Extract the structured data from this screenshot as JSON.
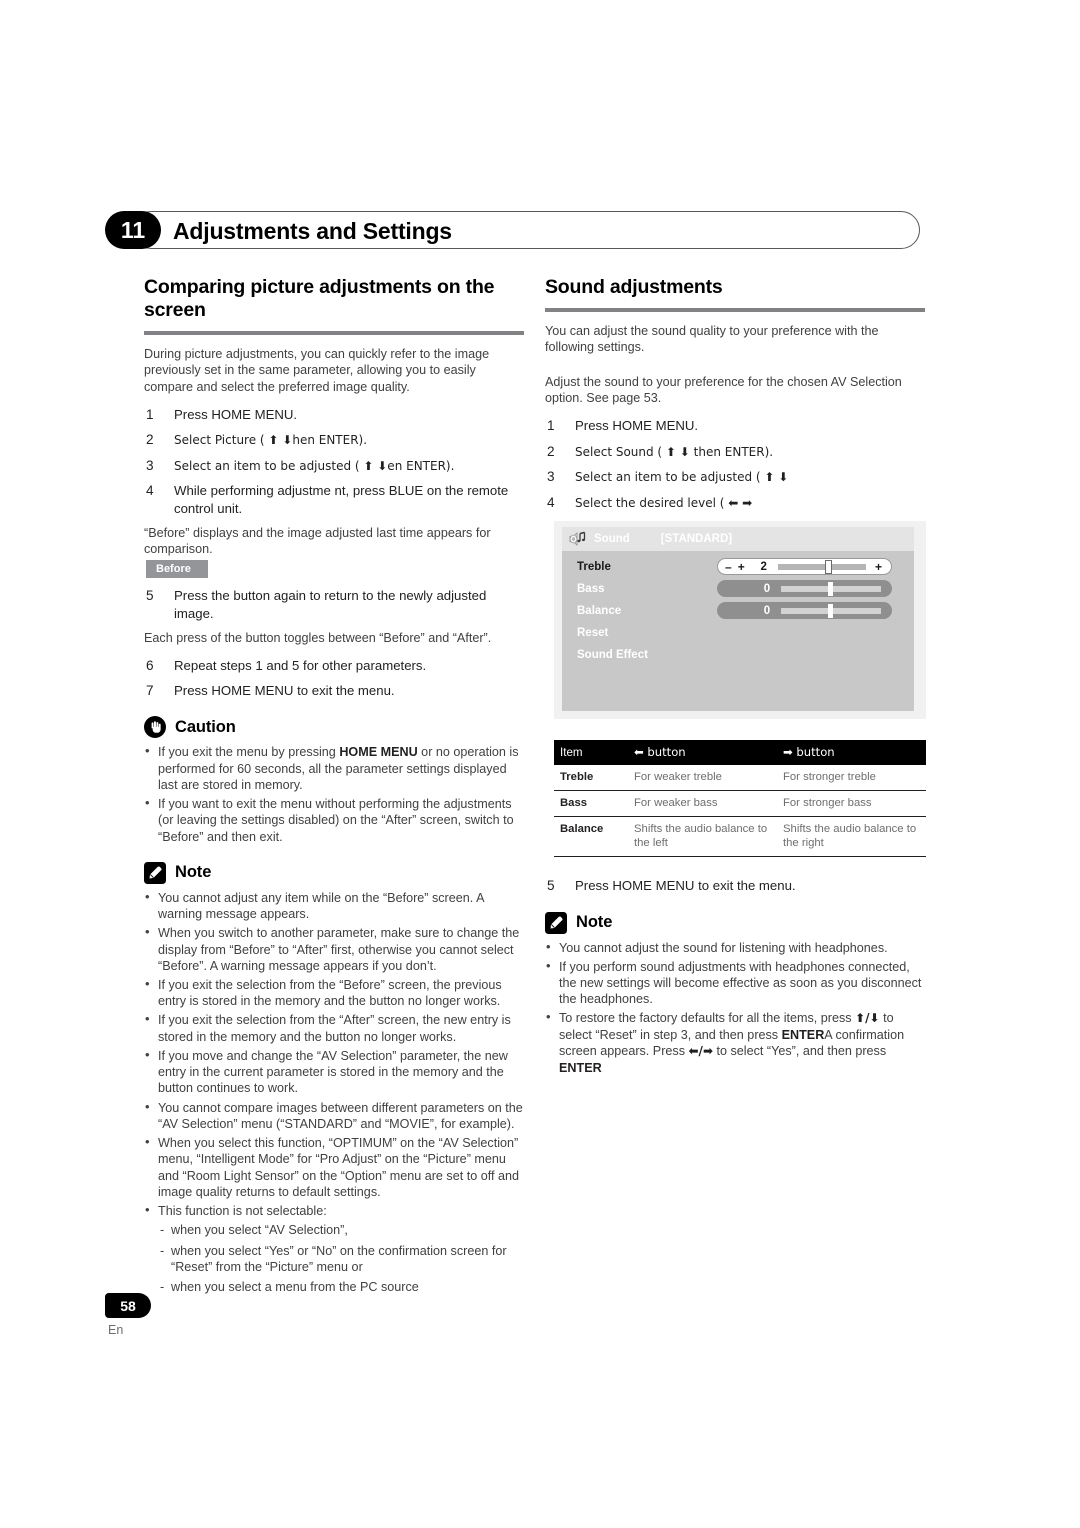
{
  "chapter": {
    "number": "11",
    "title": "Adjustments and Settings"
  },
  "left_column": {
    "heading": "Comparing picture adjustments on the screen",
    "intro": "During picture adjustments, you can quickly refer to the image previously set in the same parameter, allowing you to easily compare and select the preferred image quality.",
    "steps": [
      {
        "num": "1",
        "text": "Press HOME MENU."
      },
      {
        "num": "2",
        "text": "Select  Picture  (  ⬆ ⬇hen ENTER)."
      },
      {
        "num": "3",
        "text": "Select an item to be adjusted (   ⬆ ⬇en ENTER)."
      },
      {
        "num": "4",
        "text": "While performing adjustme    nt, press BLUE on the remote control unit."
      }
    ],
    "after_step4": "“Before” displays and the image adjusted last time appears for comparison.",
    "before_badge": "Before",
    "steps2": [
      {
        "num": "5",
        "text": "Press the button again to return to the newly adjusted image."
      }
    ],
    "after_step5": "Each press of the button toggles between “Before” and “After”.",
    "steps3": [
      {
        "num": "6",
        "text": "Repeat steps 1 and 5 for other parameters."
      },
      {
        "num": "7",
        "text": "Press HOME MENU to exit the menu."
      }
    ],
    "caution": {
      "title": "Caution",
      "icon": "hand-stop-icon",
      "bullets": [
        "If you exit the menu by pressing HOME MENU or no operation is performed for 60 seconds, all the parameter settings displayed last are stored in memory.",
        "If you want to exit the menu without performing the adjustments (or leaving the settings disabled) on the “After” screen, switch to “Before” and then exit."
      ],
      "bullet1_bold": "HOME MENU"
    },
    "note": {
      "title": "Note",
      "icon": "pencil-icon",
      "bullets": [
        "You cannot adjust any item while on the “Before” screen. A warning message appears.",
        "When you switch to another parameter, make sure to change the display from “Before” to “After” first, otherwise you cannot select “Before”. A warning message appears if you don’t.",
        "If you exit the selection from the “Before” screen, the previous entry is stored in the memory and the button no longer works.",
        "If you exit the selection from the “After” screen, the new entry is stored in the memory and the button no longer works.",
        "If you move and change the “AV Selection” parameter, the new entry in the current parameter is stored in the memory and the button continues to work.",
        "You cannot compare images between different parameters on the “AV Selection” menu (“STANDARD” and “MOVIE”, for example).",
        "When you select this function, “OPTIMUM” on the “AV Selection” menu, “Intelligent Mode” for “Pro Adjust” on the “Picture” menu and “Room Light Sensor” on the “Option” menu are set to off and image quality returns to default settings.",
        "This function is not selectable:"
      ],
      "sub_items": [
        "when you select “AV Selection”,",
        "when you select “Yes” or “No” on the confirmation screen for “Reset” from the “Picture” menu or",
        "when you select a menu from the PC source"
      ]
    }
  },
  "right_column": {
    "heading": "Sound adjustments",
    "intro": "You can adjust the sound quality to your preference with the following settings.",
    "intro2": "Adjust the sound to your preference for the chosen AV Selection option. See page 53.",
    "steps": [
      {
        "num": "1",
        "text": "Press HOME MENU."
      },
      {
        "num": "2",
        "text": "Select  Sound  (  ⬆ ⬇ then ENTER)."
      },
      {
        "num": "3",
        "text": "Select an item to be adjusted (  ⬆ ⬇"
      },
      {
        "num": "4",
        "text": "Select the desired level (  ⬅ ➡"
      }
    ],
    "osd": {
      "speaker_icon": "speaker-music-icon",
      "title": "Sound",
      "mode": "[STANDARD]",
      "rows": [
        {
          "label": "Treble",
          "value": "2",
          "selected": true,
          "knob_pct": 59
        },
        {
          "label": "Bass",
          "value": "0",
          "selected": false,
          "knob_pct": 50
        },
        {
          "label": "Balance",
          "value": "0",
          "selected": false,
          "knob_pct": 50
        },
        {
          "label": "Reset",
          "value": "",
          "selected": false,
          "knob_pct": 0
        },
        {
          "label": "Sound Effect",
          "value": "",
          "selected": false,
          "knob_pct": 0
        }
      ]
    },
    "table": {
      "headers": [
        "Item",
        "⬅ button",
        "➡ button"
      ],
      "rows": [
        [
          "Treble",
          "For weaker treble",
          "For stronger treble"
        ],
        [
          "Bass",
          "For weaker bass",
          "For stronger bass"
        ],
        [
          "Balance",
          "Shifts the audio balance to the left",
          "Shifts the audio balance to the right"
        ]
      ]
    },
    "step5": {
      "num": "5",
      "text": "Press HOME MENU to exit the menu."
    },
    "note": {
      "title": "Note",
      "icon": "pencil-icon",
      "bullets": [
        "You cannot adjust the sound for listening with headphones.",
        "If you perform sound adjustments with headphones connected, the new settings will become effective as soon as you disconnect the headphones."
      ],
      "bullet3_parts": {
        "a": "To restore the factory defaults for all the items, press ",
        "arrows1": "⬆/⬇",
        "b": " to select “Reset” in step 3, and then press ",
        "enter1": "ENTER",
        "c": "A confirmation screen appears. Press ",
        "arrows2": "⬅/➡",
        "d": " to select “Yes”, and then press ",
        "enter2": "ENTER"
      }
    }
  },
  "footer": {
    "page_number": "58",
    "language": "En"
  },
  "colors": {
    "rule": "#808285",
    "badge_gray": "#939598",
    "body_text": "#414042",
    "black": "#000000"
  }
}
